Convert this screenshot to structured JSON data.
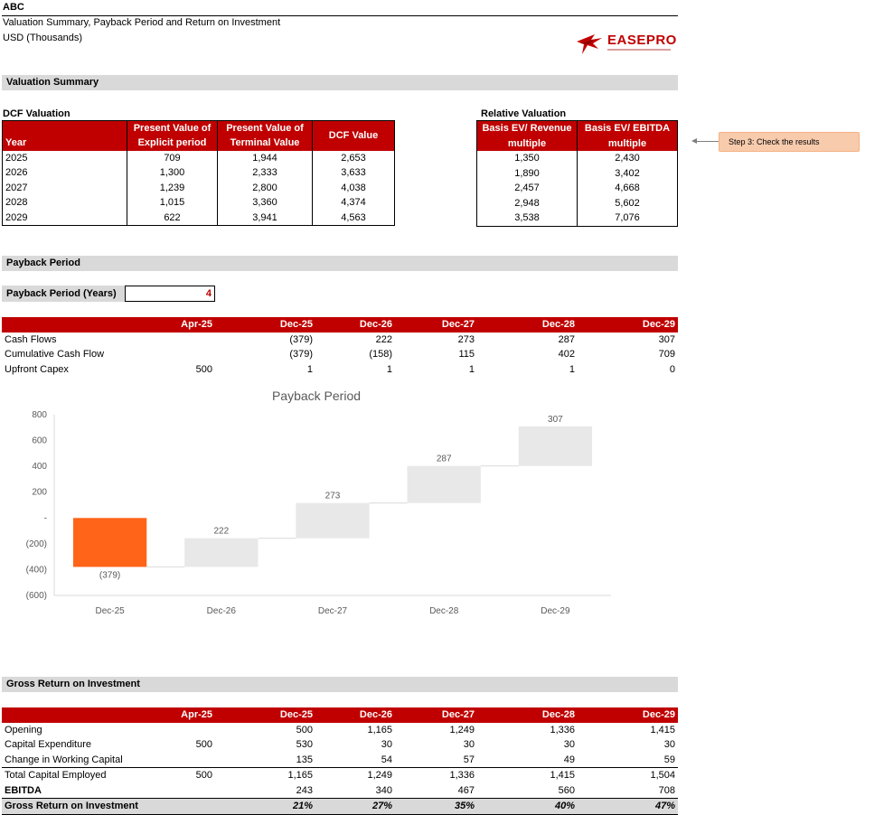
{
  "header": {
    "company": "ABC",
    "title": "Valuation Summary, Payback Period and Return on Investment",
    "units": "USD (Thousands)",
    "logo_text": "EASEPRO"
  },
  "colors": {
    "accent": "#c00000",
    "section_bg": "#d9d9d9",
    "bar_negative": "#ff6418",
    "bar_positive": "#e8e8e8",
    "callout_bg": "#f8cbad"
  },
  "valuation": {
    "section_label": "Valuation Summary",
    "dcf": {
      "label": "DCF Valuation",
      "headers": [
        "Year",
        "Present Value of Explicit period",
        "Present Value of Terminal Value",
        "DCF Value"
      ],
      "header_line1": [
        "",
        "Present Value of",
        "Present Value of",
        ""
      ],
      "header_line2": [
        "Year",
        "Explicit period",
        "Terminal Value",
        ""
      ],
      "dcf_value_header": "DCF Value",
      "rows": [
        [
          "2025",
          "709",
          "1,944",
          "2,653"
        ],
        [
          "2026",
          "1,300",
          "2,333",
          "3,633"
        ],
        [
          "2027",
          "1,239",
          "2,800",
          "4,038"
        ],
        [
          "2028",
          "1,015",
          "3,360",
          "4,374"
        ],
        [
          "2029",
          "622",
          "3,941",
          "4,563"
        ]
      ]
    },
    "relative": {
      "label": "Relative Valuation",
      "header_line1": [
        "Basis EV/ Revenue",
        "Basis EV/ EBITDA"
      ],
      "header_line2": [
        "multiple",
        "multiple"
      ],
      "rows": [
        [
          "1,350",
          "2,430"
        ],
        [
          "1,890",
          "3,402"
        ],
        [
          "2,457",
          "4,668"
        ],
        [
          "2,948",
          "5,602"
        ],
        [
          "3,538",
          "7,076"
        ]
      ]
    },
    "callout": "Step 3: Check the results"
  },
  "payback": {
    "section_label": "Payback Period",
    "input_label": "Payback Period (Years)",
    "input_value": "4",
    "columns": [
      "",
      "Apr-25",
      "Dec-25",
      "Dec-26",
      "Dec-27",
      "Dec-28",
      "Dec-29"
    ],
    "rows": [
      [
        "Cash Flows",
        "",
        "(379)",
        "222",
        "273",
        "287",
        "307"
      ],
      [
        "Cumulative Cash Flow",
        "",
        "(379)",
        "(158)",
        "115",
        "402",
        "709"
      ],
      [
        "Upfront Capex",
        "500",
        "1",
        "1",
        "1",
        "1",
        "0"
      ]
    ]
  },
  "chart_data": {
    "type": "bar",
    "subtype": "waterfall",
    "title": "Payback Period",
    "categories": [
      "Dec-25",
      "Dec-26",
      "Dec-27",
      "Dec-28",
      "Dec-29"
    ],
    "values": [
      -379,
      222,
      273,
      287,
      307
    ],
    "value_labels": [
      "(379)",
      "222",
      "273",
      "287",
      "307"
    ],
    "ylim": [
      -600,
      800
    ],
    "yticks": [
      -600,
      -400,
      -200,
      0,
      200,
      400,
      600,
      800
    ],
    "ytick_labels": [
      "(600)",
      "(400)",
      "(200)",
      "-",
      "200",
      "400",
      "600",
      "800"
    ],
    "grid": false,
    "legend": "none"
  },
  "gri": {
    "section_label": "Gross Return on Investment",
    "columns": [
      "",
      "Apr-25",
      "Dec-25",
      "Dec-26",
      "Dec-27",
      "Dec-28",
      "Dec-29"
    ],
    "rows": [
      [
        "Opening",
        "",
        "500",
        "1,165",
        "1,249",
        "1,336",
        "1,415"
      ],
      [
        "Capital Expenditure",
        "500",
        "530",
        "30",
        "30",
        "30",
        "30"
      ],
      [
        "Change in Working Capital",
        "",
        "135",
        "54",
        "57",
        "49",
        "59"
      ]
    ],
    "total_row": [
      "Total Capital Employed",
      "500",
      "1,165",
      "1,249",
      "1,336",
      "1,415",
      "1,504"
    ],
    "ebitda_row": [
      "EBITDA",
      "",
      "243",
      "340",
      "467",
      "560",
      "708"
    ],
    "return_row": [
      "Gross Return on Investment",
      "",
      "21%",
      "27%",
      "35%",
      "40%",
      "47%"
    ]
  }
}
